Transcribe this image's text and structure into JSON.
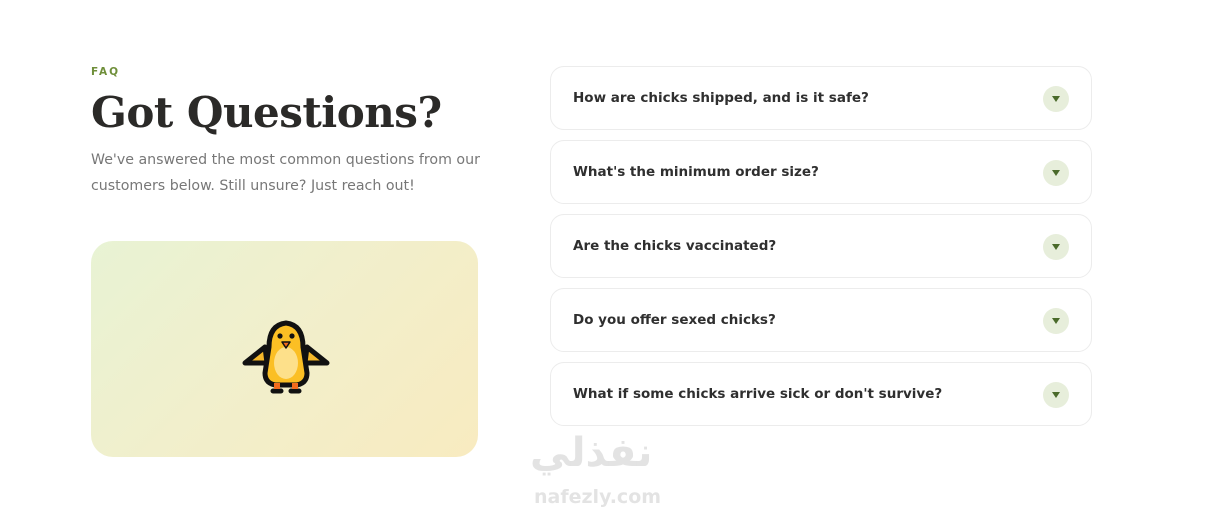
{
  "intro": {
    "eyebrow": "FAQ",
    "title": "Got Questions?",
    "description": "We've answered the most common questions from our customers below. Still unsure? Just reach out!"
  },
  "illustration": {
    "icon": "baby-chick-icon"
  },
  "faq": {
    "items": [
      {
        "question": "How are chicks shipped, and is it safe?"
      },
      {
        "question": "What's the minimum order size?"
      },
      {
        "question": "Are the chicks vaccinated?"
      },
      {
        "question": "Do you offer sexed chicks?"
      },
      {
        "question": "What if some chicks arrive sick or don't survive?"
      }
    ],
    "toggle_icon": "triangle-down-icon"
  },
  "watermark": {
    "arabic": "نفذلي",
    "latin": "nafezly.com"
  },
  "colors": {
    "accent": "#6f8f3a",
    "toggle_bg": "#e7eedb",
    "toggle_arrow": "#4a6a2a",
    "chick": "#fbbf24"
  }
}
